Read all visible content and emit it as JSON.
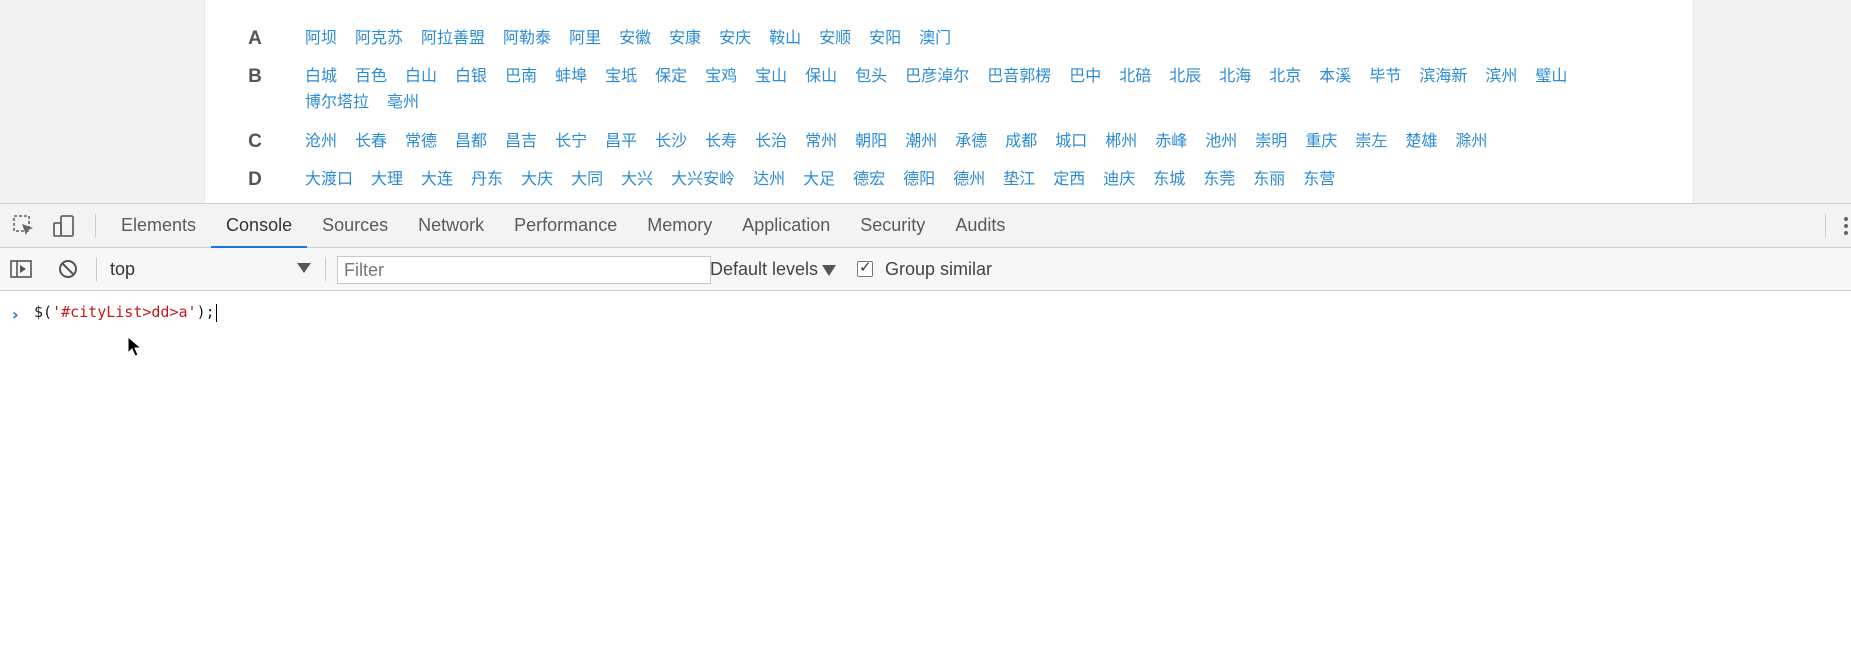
{
  "city_list": [
    {
      "letter": "A",
      "cities": [
        "阿坝",
        "阿克苏",
        "阿拉善盟",
        "阿勒泰",
        "阿里",
        "安徽",
        "安康",
        "安庆",
        "鞍山",
        "安顺",
        "安阳",
        "澳门"
      ]
    },
    {
      "letter": "B",
      "cities": [
        "白城",
        "百色",
        "白山",
        "白银",
        "巴南",
        "蚌埠",
        "宝坻",
        "保定",
        "宝鸡",
        "宝山",
        "保山",
        "包头",
        "巴彦淖尔",
        "巴音郭楞",
        "巴中",
        "北碚",
        "北辰",
        "北海",
        "北京",
        "本溪",
        "毕节",
        "滨海新",
        "滨州",
        "璧山",
        "博尔塔拉",
        "亳州"
      ]
    },
    {
      "letter": "C",
      "cities": [
        "沧州",
        "长春",
        "常德",
        "昌都",
        "昌吉",
        "长宁",
        "昌平",
        "长沙",
        "长寿",
        "长治",
        "常州",
        "朝阳",
        "潮州",
        "承德",
        "成都",
        "城口",
        "郴州",
        "赤峰",
        "池州",
        "崇明",
        "重庆",
        "崇左",
        "楚雄",
        "滁州"
      ]
    },
    {
      "letter": "D",
      "cities": [
        "大渡口",
        "大理",
        "大连",
        "丹东",
        "大庆",
        "大同",
        "大兴",
        "大兴安岭",
        "达州",
        "大足",
        "德宏",
        "德阳",
        "德州",
        "垫江",
        "定西",
        "迪庆",
        "东城",
        "东莞",
        "东丽",
        "东营"
      ]
    }
  ],
  "devtools": {
    "tabs": [
      "Elements",
      "Console",
      "Sources",
      "Network",
      "Performance",
      "Memory",
      "Application",
      "Security",
      "Audits"
    ],
    "active_tab": "Console",
    "context": "top",
    "filter_placeholder": "Filter",
    "levels_label": "Default levels",
    "group_similar_label": "Group similar",
    "group_similar_checked": true,
    "console_input": {
      "prefix": "$(",
      "string": "'#cityList>dd>a'",
      "suffix": ");"
    }
  },
  "colors": {
    "link": "#2d8bd4",
    "accent": "#1a73e8",
    "string_token": "#c41a16"
  },
  "icons": [
    "inspect-element-icon",
    "device-toolbar-icon",
    "more-options-icon",
    "console-sidebar-icon",
    "clear-console-icon",
    "prompt-chevron-icon",
    "mouse-pointer-icon"
  ]
}
